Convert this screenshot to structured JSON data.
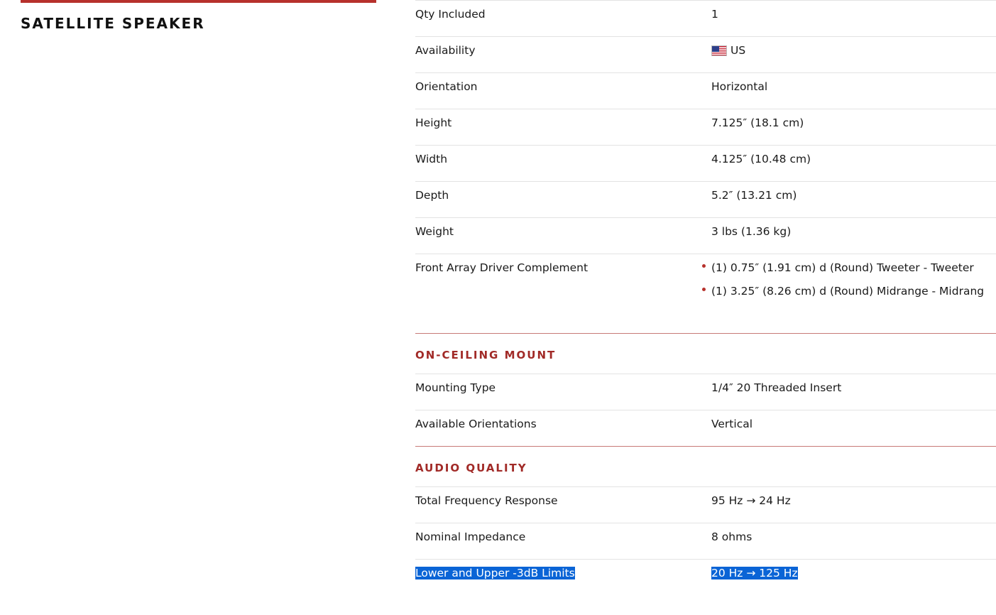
{
  "left": {
    "title": "SATELLITE SPEAKER"
  },
  "colors": {
    "accent": "#b7312c",
    "heading": "#a12a27",
    "selection": "#0a64d6"
  },
  "specs": [
    {
      "label": "Qty Included",
      "value": "1"
    },
    {
      "label": "Availability",
      "value": "US",
      "icon": "us-flag-icon"
    },
    {
      "label": "Orientation",
      "value": "Horizontal"
    },
    {
      "label": "Height",
      "value": "7.125″ (18.1 cm)"
    },
    {
      "label": "Width",
      "value": "4.125″ (10.48 cm)"
    },
    {
      "label": "Depth",
      "value": "5.2″ (13.21 cm)"
    },
    {
      "label": "Weight",
      "value": "3 lbs (1.36 kg)"
    }
  ],
  "driver": {
    "label": "Front Array Driver Complement",
    "items": [
      "(1)  0.75″ (1.91 cm) d (Round) Tweeter - Tweeter",
      "(1)  3.25″ (8.26 cm) d (Round) Midrange - Midrang"
    ]
  },
  "mount": {
    "heading": "ON-CEILING MOUNT",
    "rows": [
      {
        "label": "Mounting Type",
        "value": "1/4″ 20 Threaded Insert"
      },
      {
        "label": "Available Orientations",
        "value": "Vertical"
      }
    ]
  },
  "audio": {
    "heading": "AUDIO QUALITY",
    "rows": [
      {
        "label": "Total Frequency Response",
        "value": "95 Hz → 24 Hz"
      },
      {
        "label": "Nominal Impedance",
        "value": "8 ohms"
      },
      {
        "label": "Lower and Upper -3dB Limits",
        "value": "20 Hz → 125 Hz"
      }
    ]
  }
}
